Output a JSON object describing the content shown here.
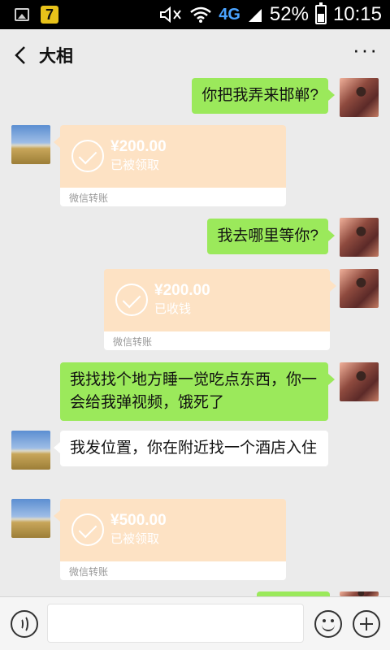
{
  "status_bar": {
    "app_icon_label": "7",
    "network": "4G",
    "battery_percent": "52%",
    "battery_level": 0.52,
    "time": "10:15"
  },
  "header": {
    "title": "大相",
    "more_label": "···"
  },
  "messages": [
    {
      "side": "right",
      "type": "text",
      "text": "你把我弄来邯郸?"
    },
    {
      "side": "left",
      "type": "transfer",
      "amount": "¥200.00",
      "status": "已被领取",
      "label": "微信转账"
    },
    {
      "side": "right",
      "type": "text",
      "text": "我去哪里等你?"
    },
    {
      "side": "right",
      "type": "transfer",
      "amount": "¥200.00",
      "status": "已收钱",
      "label": "微信转账"
    },
    {
      "side": "right",
      "type": "text",
      "text": "我找找个地方睡一觉吃点东西，你一会给我弹视频，饿死了"
    },
    {
      "side": "left",
      "type": "text",
      "text": "我发位置，你在附近找一个酒店入住"
    },
    {
      "side": "left",
      "type": "transfer",
      "amount": "¥500.00",
      "status": "已被领取",
      "label": "微信转账"
    }
  ],
  "input": {
    "value": ""
  },
  "colors": {
    "green_bubble": "#9be95b",
    "transfer_bg": "#fde2c4",
    "chat_bg": "#ebebeb"
  }
}
